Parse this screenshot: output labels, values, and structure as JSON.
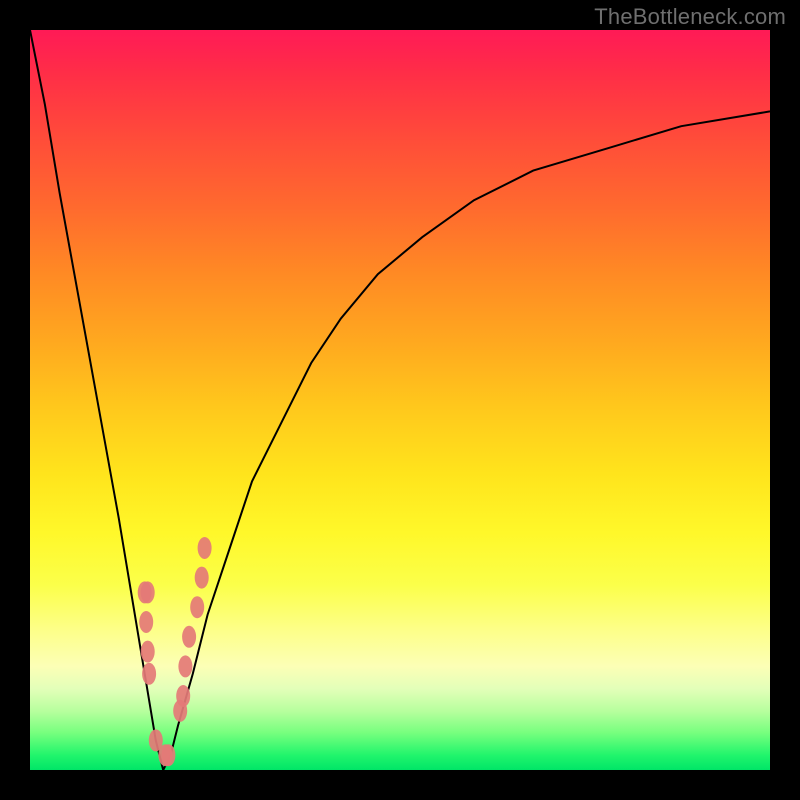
{
  "watermark": "TheBottleneck.com",
  "colors": {
    "frame": "#000000",
    "curve": "#000000",
    "dots": "#e47a77"
  },
  "chart_data": {
    "type": "line",
    "title": "",
    "xlabel": "",
    "ylabel": "",
    "xlim": [
      0,
      100
    ],
    "ylim": [
      0,
      100
    ],
    "series": [
      {
        "name": "bottleneck-curve",
        "x": [
          0,
          2,
          4,
          6,
          8,
          10,
          12,
          14,
          15,
          16,
          17,
          18,
          19,
          20,
          22,
          24,
          27,
          30,
          34,
          38,
          42,
          47,
          53,
          60,
          68,
          78,
          88,
          100
        ],
        "y": [
          100,
          90,
          78,
          67,
          56,
          45,
          34,
          22,
          16,
          10,
          4,
          0,
          2,
          6,
          13,
          21,
          30,
          39,
          47,
          55,
          61,
          67,
          72,
          77,
          81,
          84,
          87,
          89
        ]
      }
    ],
    "points": {
      "name": "sampled-hardware",
      "x": [
        15.5,
        15.7,
        15.9,
        16.1,
        17.0,
        18.3,
        18.7,
        15.9,
        20.3,
        20.7,
        21.0,
        21.5,
        22.6,
        23.2,
        23.6
      ],
      "y": [
        24,
        20,
        16,
        13,
        4,
        2,
        2,
        24,
        8,
        10,
        14,
        18,
        22,
        26,
        30
      ]
    }
  }
}
